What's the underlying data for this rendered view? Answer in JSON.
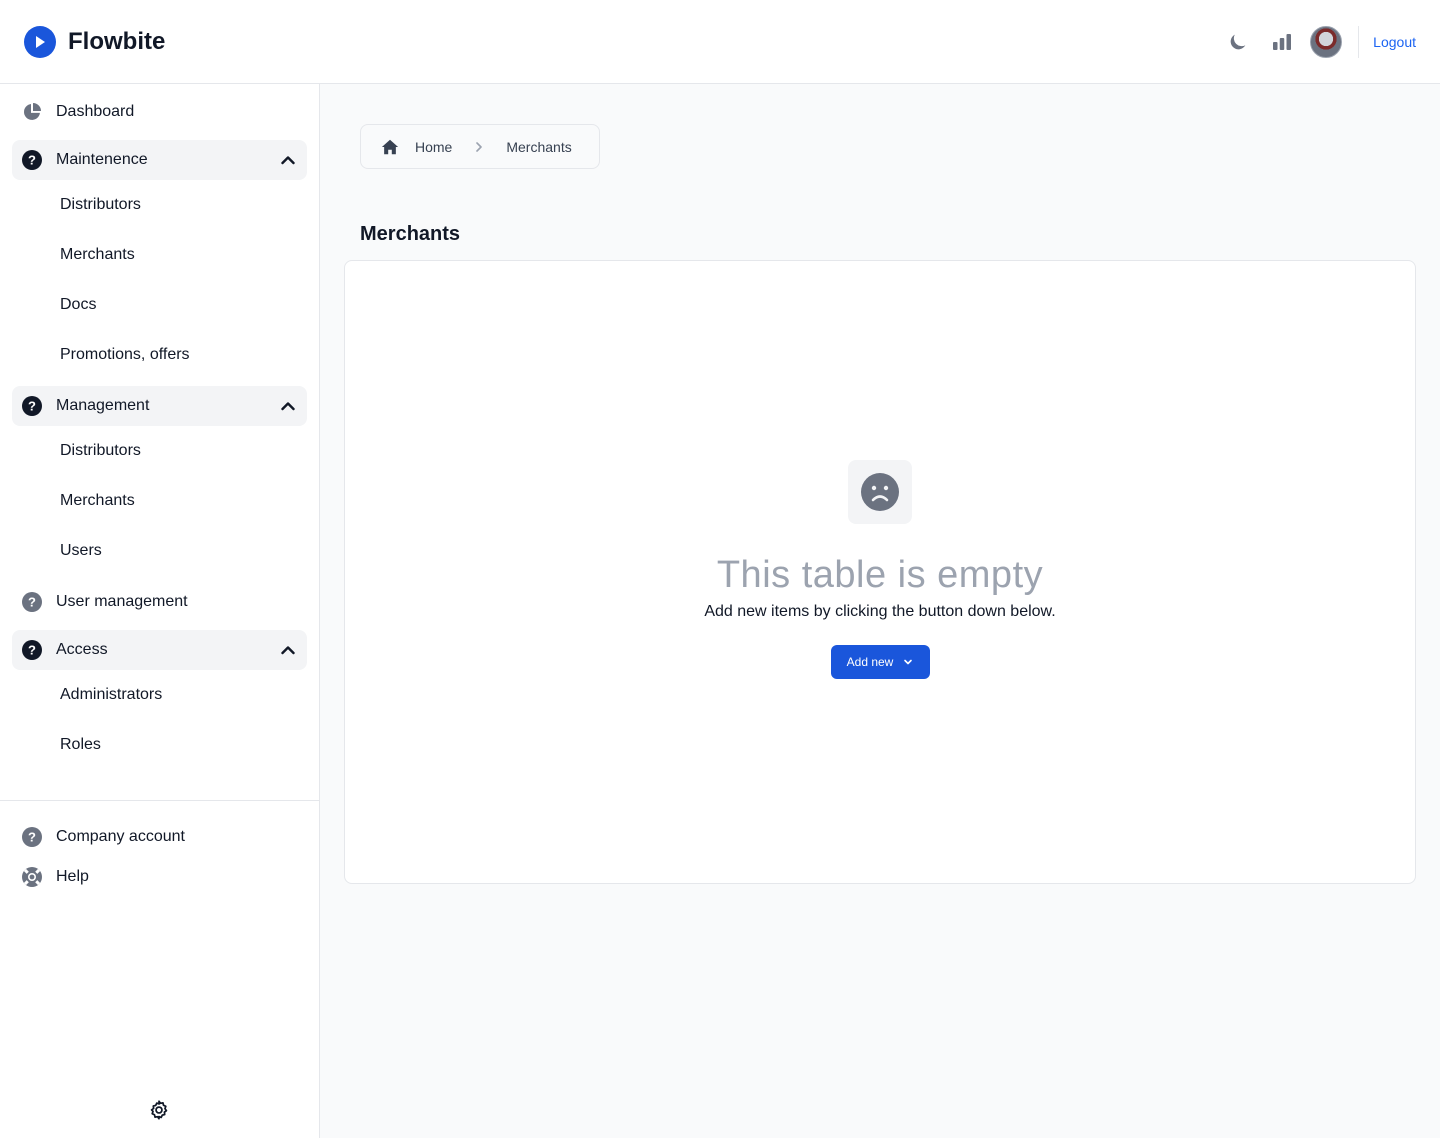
{
  "header": {
    "brand_name": "Flowbite",
    "logout_label": "Logout",
    "icons": [
      "moon-icon",
      "chart-bars-icon",
      "user-avatar"
    ]
  },
  "sidebar": {
    "items": [
      {
        "label": "Dashboard",
        "icon": "pie-chart-icon",
        "type": "link"
      },
      {
        "label": "Maintenence",
        "icon": "question-circle-icon",
        "type": "group",
        "expanded": true,
        "children": [
          "Distributors",
          "Merchants",
          "Docs",
          "Promotions, offers"
        ]
      },
      {
        "label": "Management",
        "icon": "question-circle-icon",
        "type": "group",
        "expanded": true,
        "children": [
          "Distributors",
          "Merchants",
          "Users"
        ]
      },
      {
        "label": "User management",
        "icon": "question-circle-icon",
        "type": "link"
      },
      {
        "label": "Access",
        "icon": "question-circle-icon",
        "type": "group",
        "expanded": true,
        "children": [
          "Administrators",
          "Roles"
        ]
      }
    ],
    "bottom_items": [
      {
        "label": "Company account",
        "icon": "question-circle-icon"
      },
      {
        "label": "Help",
        "icon": "lifebuoy-icon"
      }
    ],
    "settings_icon": "gear-icon"
  },
  "breadcrumb": {
    "items": [
      "Home",
      "Merchants"
    ]
  },
  "main": {
    "page_title": "Merchants",
    "empty_state": {
      "icon": "sad-face-icon",
      "title": "This table is empty",
      "subtitle": "Add new items by clicking the button down below.",
      "button_label": "Add new"
    }
  },
  "colors": {
    "primary": "#1a56db",
    "link": "#1c64f2",
    "group_bg": "#f3f4f6",
    "page_bg": "#f9fafb",
    "border": "#e5e7eb"
  }
}
